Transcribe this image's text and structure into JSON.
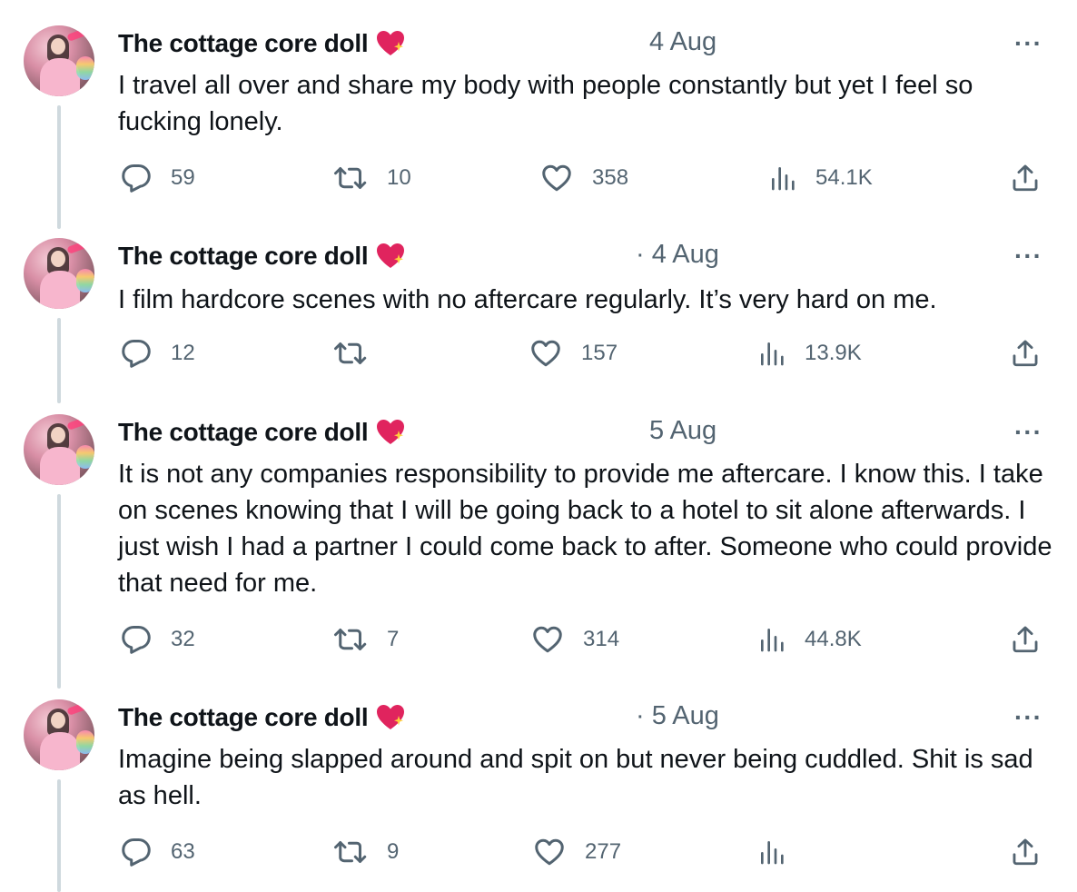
{
  "tweets": [
    {
      "name": "The cottage core doll",
      "date": "4 Aug",
      "more": "···",
      "text": "I travel all over and share my body with people constantly but yet I feel so fucking lonely.",
      "replies": "59",
      "retweets": "10",
      "likes": "358",
      "views": "54.1K"
    },
    {
      "name": "The cottage core doll",
      "date": "· 4 Aug",
      "more": "···",
      "text": "I film hardcore scenes with no aftercare regularly. It’s very hard on me.",
      "replies": "12",
      "retweets": "",
      "likes": "157",
      "views": "13.9K"
    },
    {
      "name": "The cottage core doll",
      "date": "5 Aug",
      "more": "···",
      "text": "It is not any companies responsibility to provide me aftercare. I know this. I take on scenes knowing that I will be going back to a hotel to sit alone afterwards. I just wish I had a partner I could come back to after. Someone who could provide that need for me.",
      "replies": "32",
      "retweets": "7",
      "likes": "314",
      "views": "44.8K"
    },
    {
      "name": "The cottage core doll",
      "date": "· 5 Aug",
      "more": "···",
      "text": "Imagine being slapped around and spit on but never being cuddled. Shit is sad as hell.",
      "replies": "63",
      "retweets": "9",
      "likes": "277",
      "views": ""
    }
  ],
  "icons": {
    "reply": "reply-icon",
    "retweet": "retweet-icon",
    "like": "heart-icon",
    "views": "views-icon",
    "share": "share-icon",
    "badge": "sparkling-heart-icon"
  },
  "colors": {
    "text": "#0f1419",
    "secondary": "#536471",
    "thread": "#cfd9de",
    "heart": "#e0245e"
  }
}
